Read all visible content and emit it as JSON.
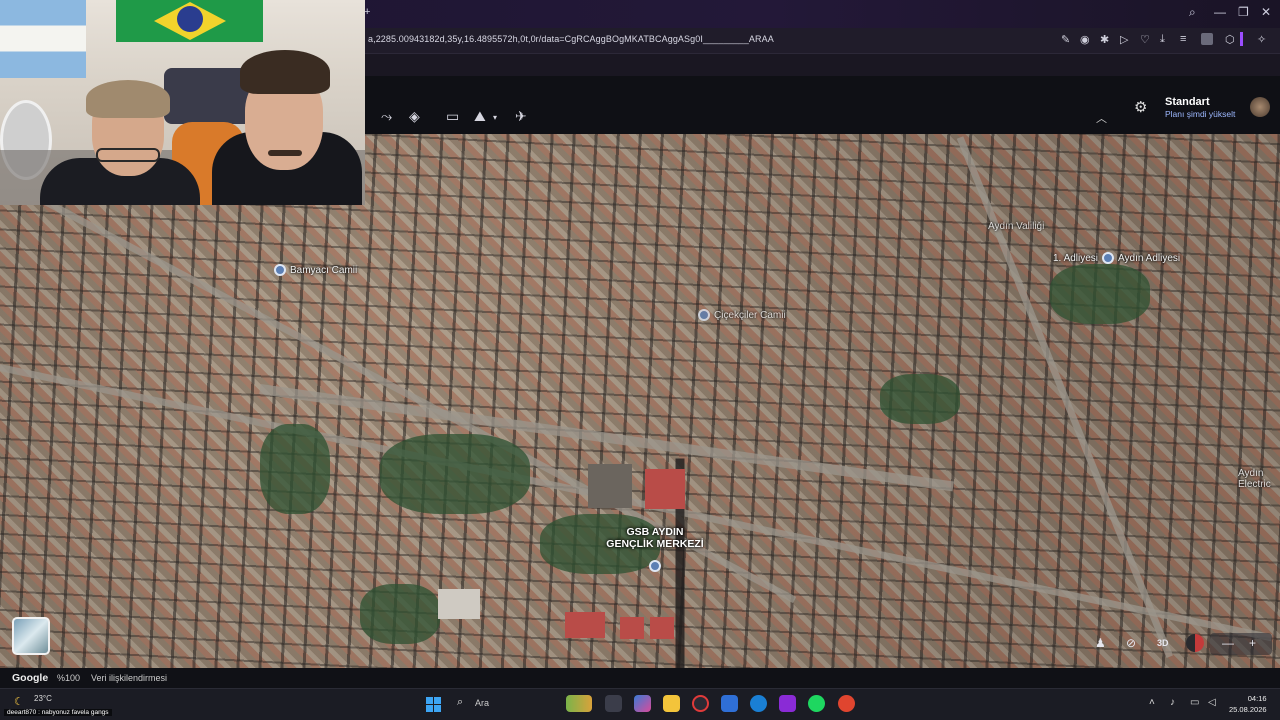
{
  "browser": {
    "url": "a,2285.00943182d,35y,16.4895572h,0t,0r/data=CgRCAggBOgMKATBCAggASg0I_________ARAA"
  },
  "earth_app": {
    "plan_title": "Standart",
    "plan_subtitle": "Planı şimdi yükselt"
  },
  "map": {
    "places": [
      {
        "name": "Bamyacı Camii"
      },
      {
        "name": "Çiçekçiler Camii"
      },
      {
        "name": "Aydın Valiliği"
      },
      {
        "name": "Aydın Adliyesi"
      },
      {
        "name": "1. Adliyesi"
      },
      {
        "name": "Aydın\nElectric"
      }
    ],
    "big_label_line1": "GSB AYDIN",
    "big_label_line2": "GENÇLİK MERKEZİ",
    "mode_3d": "3D"
  },
  "footer": {
    "brand": "Google",
    "zoom": "%100",
    "credit": "Veri ilişkilendirmesi"
  },
  "taskbar": {
    "temperature": "23°C",
    "ticker": "deeart870 : nabyonuz favela gangs",
    "search_label": "Ara",
    "time": "04:16",
    "date": "25.08.2026"
  },
  "colors": {
    "accent": "#9db8ff",
    "pin": "#5c7fb4",
    "roof": "#b94c48"
  }
}
